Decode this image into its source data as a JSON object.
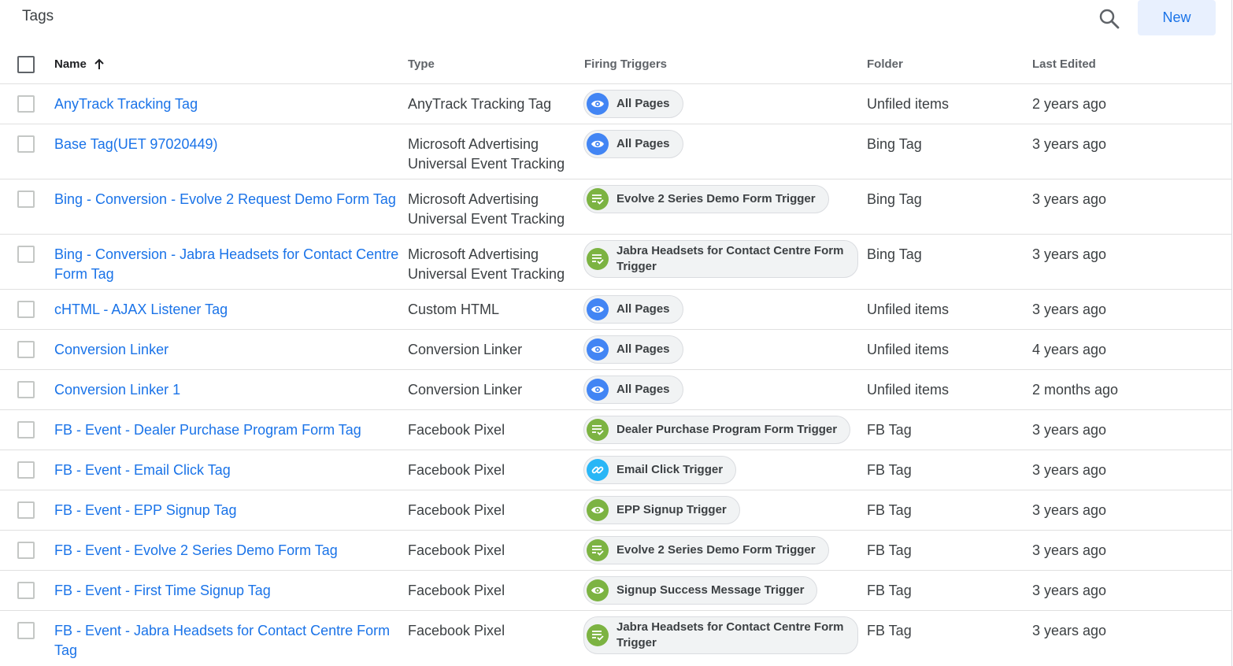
{
  "header": {
    "title": "Tags",
    "new_label": "New",
    "search_icon": "search-icon"
  },
  "columns": {
    "name": "Name",
    "type": "Type",
    "triggers": "Firing Triggers",
    "folder": "Folder",
    "edited": "Last Edited",
    "sort_icon": "arrow-up-icon"
  },
  "colors": {
    "link": "#1a73e8",
    "pageview_icon": "#4285f4",
    "form_icon": "#7cb342",
    "click_icon": "#29b6f6",
    "new_button_bg": "#e8f0fe"
  },
  "rows": [
    {
      "name": "AnyTrack Tracking Tag",
      "type": "AnyTrack Tracking Tag",
      "trigger": "All Pages",
      "trigger_icon": "eye-icon",
      "folder": "Unfiled items",
      "edited": "2 years ago"
    },
    {
      "name": "Base Tag(UET 97020449)",
      "type": "Microsoft Advertising Universal Event Tracking",
      "trigger": "All Pages",
      "trigger_icon": "eye-icon",
      "folder": "Bing Tag",
      "edited": "3 years ago"
    },
    {
      "name": "Bing - Conversion - Evolve 2 Request Demo Form Tag",
      "type": "Microsoft Advertising Universal Event Tracking",
      "trigger": "Evolve 2 Series Demo Form Trigger",
      "trigger_icon": "form-submit-icon",
      "folder": "Bing Tag",
      "edited": "3 years ago"
    },
    {
      "name": "Bing - Conversion - Jabra Headsets for Contact Centre Form Tag",
      "type": "Microsoft Advertising Universal Event Tracking",
      "trigger": "Jabra Headsets for Contact Centre Form Trigger",
      "trigger_icon": "form-submit-icon",
      "folder": "Bing Tag",
      "edited": "3 years ago"
    },
    {
      "name": "cHTML - AJAX Listener Tag",
      "type": "Custom HTML",
      "trigger": "All Pages",
      "trigger_icon": "eye-icon",
      "folder": "Unfiled items",
      "edited": "3 years ago"
    },
    {
      "name": "Conversion Linker",
      "type": "Conversion Linker",
      "trigger": "All Pages",
      "trigger_icon": "eye-icon",
      "folder": "Unfiled items",
      "edited": "4 years ago"
    },
    {
      "name": "Conversion Linker 1",
      "type": "Conversion Linker",
      "trigger": "All Pages",
      "trigger_icon": "eye-icon",
      "folder": "Unfiled items",
      "edited": "2 months ago"
    },
    {
      "name": "FB - Event - Dealer Purchase Program Form Tag",
      "type": "Facebook Pixel",
      "trigger": "Dealer Purchase Program Form Trigger",
      "trigger_icon": "form-submit-icon",
      "folder": "FB Tag",
      "edited": "3 years ago"
    },
    {
      "name": "FB - Event - Email Click Tag",
      "type": "Facebook Pixel",
      "trigger": "Email Click Trigger",
      "trigger_icon": "link-click-icon",
      "folder": "FB Tag",
      "edited": "3 years ago"
    },
    {
      "name": "FB - Event - EPP Signup Tag",
      "type": "Facebook Pixel",
      "trigger": "EPP Signup Trigger",
      "trigger_icon": "visibility-icon",
      "folder": "FB Tag",
      "edited": "3 years ago"
    },
    {
      "name": "FB - Event - Evolve 2 Series Demo Form Tag",
      "type": "Facebook Pixel",
      "trigger": "Evolve 2 Series Demo Form Trigger",
      "trigger_icon": "form-submit-icon",
      "folder": "FB Tag",
      "edited": "3 years ago"
    },
    {
      "name": "FB - Event - First Time Signup Tag",
      "type": "Facebook Pixel",
      "trigger": "Signup Success Message Trigger",
      "trigger_icon": "visibility-icon",
      "folder": "FB Tag",
      "edited": "3 years ago"
    },
    {
      "name": "FB - Event - Jabra Headsets for Contact Centre Form Tag",
      "type": "Facebook Pixel",
      "trigger": "Jabra Headsets for Contact Centre Form Trigger",
      "trigger_icon": "form-submit-icon",
      "folder": "FB Tag",
      "edited": "3 years ago"
    }
  ]
}
